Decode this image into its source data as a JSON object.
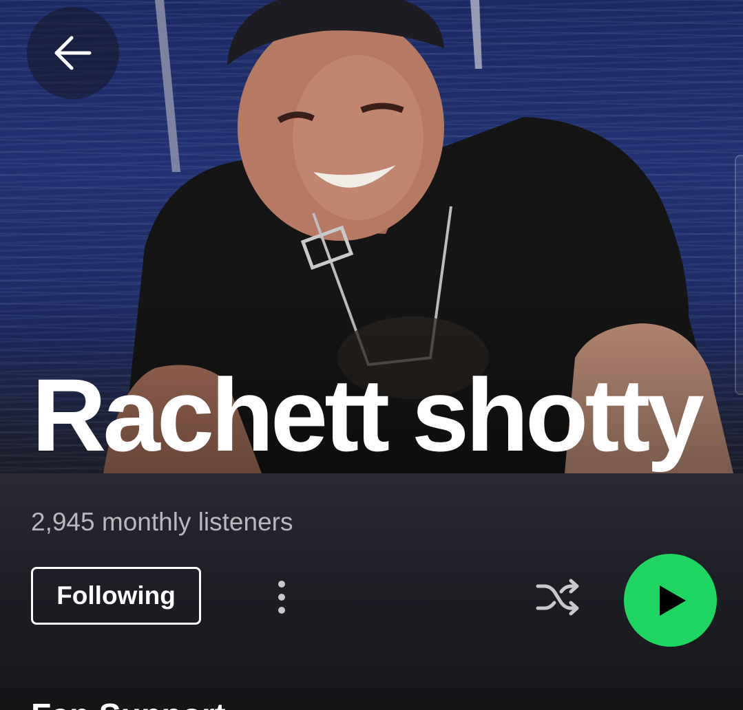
{
  "artist": {
    "name": "Rachett shotty",
    "monthly_listeners": "2,945 monthly listeners"
  },
  "actions": {
    "follow_label": "Following"
  },
  "section": {
    "heading": "Fan Support"
  },
  "colors": {
    "accent": "#1ed760",
    "background": "#121212",
    "text_primary": "#ffffff",
    "text_secondary": "#b8b8be"
  },
  "icons": {
    "back": "arrow-left-icon",
    "more": "more-vertical-icon",
    "shuffle": "shuffle-icon",
    "play": "play-icon"
  }
}
